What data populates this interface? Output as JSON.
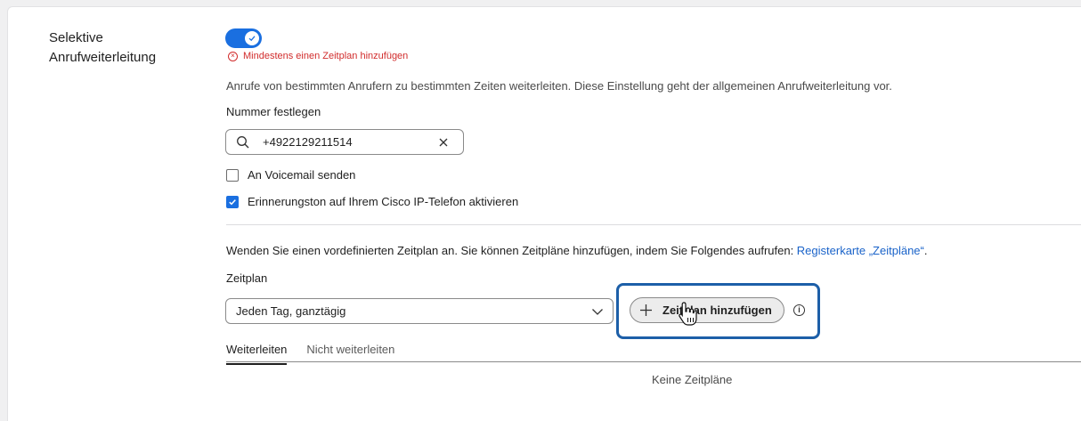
{
  "section": {
    "label": "Selektive Anrufweiterleitung",
    "toggle_on": true
  },
  "error": {
    "message": "Mindestens einen Zeitplan hinzufügen"
  },
  "description": "Anrufe von bestimmten Anrufern zu bestimmten Zeiten weiterleiten. Diese Einstellung geht der allgemeinen Anrufweiterleitung vor.",
  "number": {
    "label": "Nummer festlegen",
    "value": "+4922129211514"
  },
  "checkboxes": [
    {
      "label": "An Voicemail senden",
      "checked": false
    },
    {
      "label": "Erinnerungston auf Ihrem Cisco IP-Telefon aktivieren",
      "checked": true
    }
  ],
  "schedule": {
    "description": "Wenden Sie einen vordefinierten Zeitplan an. Sie können Zeitpläne hinzufügen, indem Sie Folgendes aufrufen: ",
    "link": "Registerkarte „Zeitpläne“",
    "link_suffix": ".",
    "label": "Zeitplan",
    "selected": "Jeden Tag, ganztägig",
    "add_button": "Zeitplan hinzufügen"
  },
  "tabs": [
    {
      "label": "Weiterleiten",
      "active": true
    },
    {
      "label": "Nicht weiterleiten",
      "active": false
    }
  ],
  "empty_state": "Keine Zeitpläne",
  "colors": {
    "accent": "#1a6fe0",
    "error": "#d12c2c",
    "link": "#1a63c9",
    "highlight": "#1d5fa8"
  }
}
